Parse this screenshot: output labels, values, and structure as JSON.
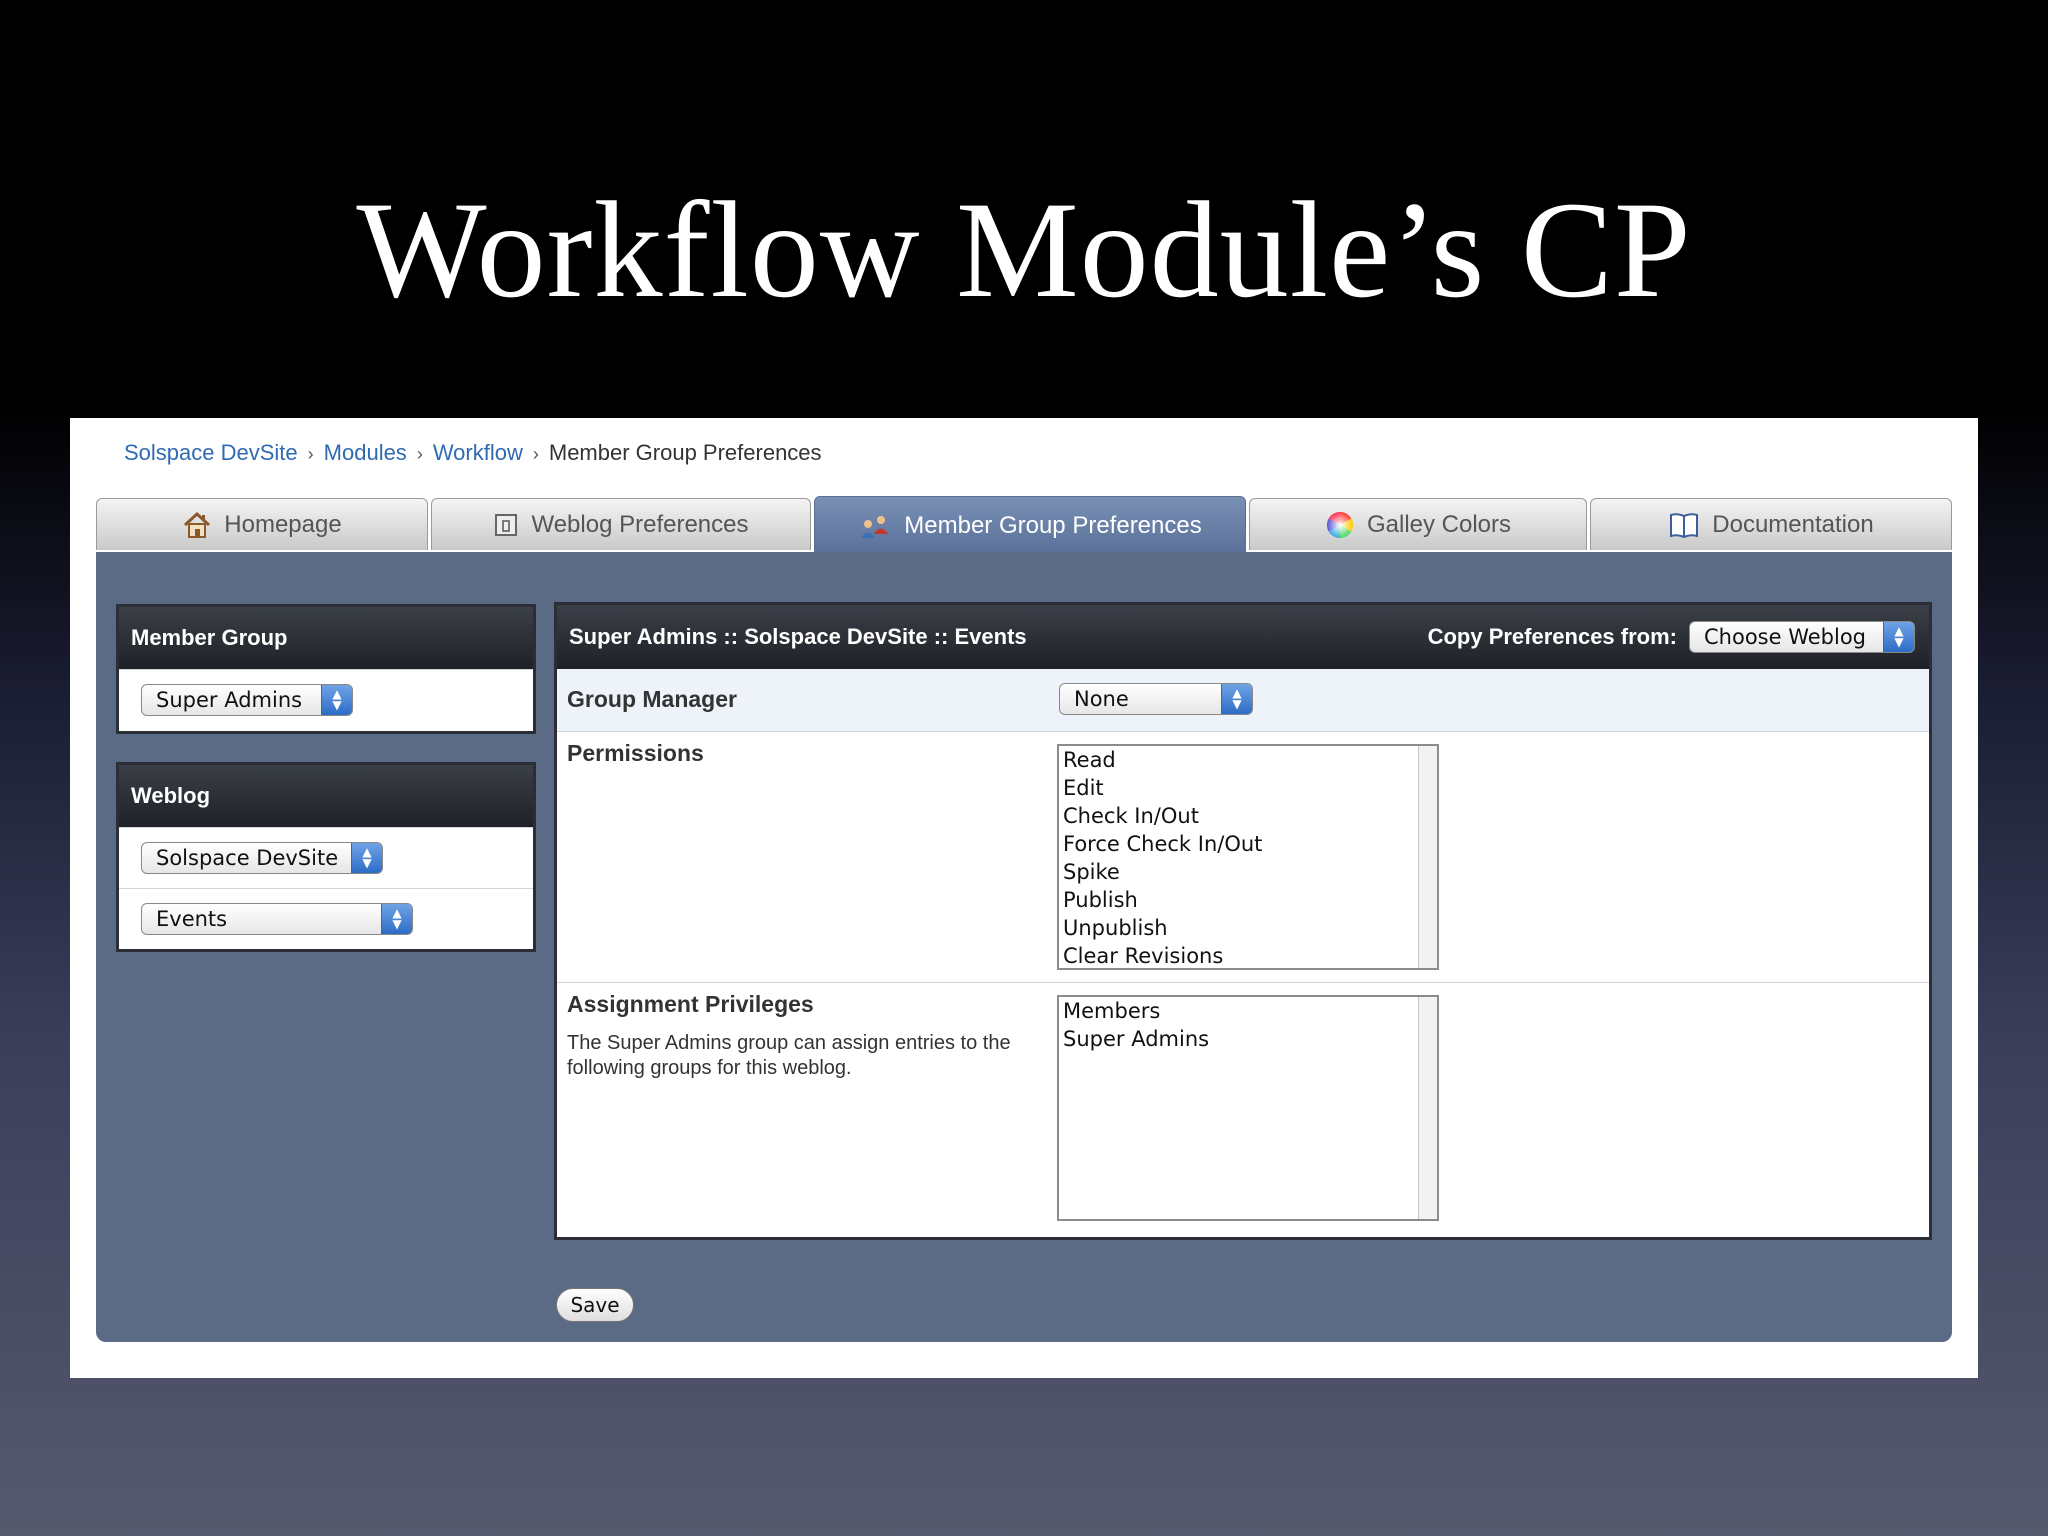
{
  "slide": {
    "title": "Workflow Module’s CP"
  },
  "breadcrumb": {
    "items": [
      "Solspace DevSite",
      "Modules",
      "Workflow"
    ],
    "current": "Member Group Preferences",
    "separator": "›"
  },
  "tabs": [
    {
      "label": "Homepage",
      "icon": "house-icon"
    },
    {
      "label": "Weblog Preferences",
      "icon": "document-icon"
    },
    {
      "label": "Member Group Preferences",
      "icon": "users-icon",
      "active": true
    },
    {
      "label": "Galley Colors",
      "icon": "color-wheel-icon"
    },
    {
      "label": "Documentation",
      "icon": "book-icon"
    }
  ],
  "sidebar": {
    "member_group": {
      "title": "Member Group",
      "selected": "Super Admins"
    },
    "weblog": {
      "title": "Weblog",
      "site_selected": "Solspace DevSite",
      "weblog_selected": "Events"
    }
  },
  "main": {
    "header_title": "Super Admins :: Solspace DevSite :: Events",
    "copy_label": "Copy Preferences from:",
    "copy_select": "Choose Weblog",
    "group_manager": {
      "label": "Group Manager",
      "selected": "None"
    },
    "permissions": {
      "label": "Permissions",
      "options": [
        "Read",
        "Edit",
        "Check In/Out",
        "Force Check In/Out",
        "Spike",
        "Publish",
        "Unpublish",
        "Clear Revisions"
      ]
    },
    "assignment": {
      "label": "Assignment Privileges",
      "description": "The Super Admins group can assign entries to the following groups for this weblog.",
      "options": [
        "Members",
        "Super Admins"
      ]
    }
  },
  "actions": {
    "save_label": "Save"
  },
  "colors": {
    "active_tab": "#5a7099",
    "panel_bg": "#5b6b86",
    "link": "#2f6bb3"
  }
}
